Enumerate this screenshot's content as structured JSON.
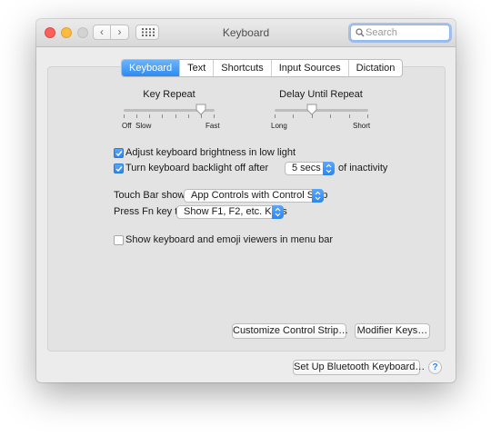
{
  "window": {
    "title": "Keyboard",
    "search_placeholder": "Search"
  },
  "tabs": [
    "Keyboard",
    "Text",
    "Shortcuts",
    "Input Sources",
    "Dictation"
  ],
  "active_tab": "Keyboard",
  "key_repeat": {
    "label": "Key Repeat",
    "left_labels": [
      "Off",
      "Slow"
    ],
    "right_label": "Fast",
    "level": 0.85
  },
  "delay_repeat": {
    "label": "Delay Until Repeat",
    "left_label": "Long",
    "right_label": "Short",
    "level": 0.4
  },
  "options": {
    "brightness": {
      "label": "Adjust keyboard brightness in low light",
      "checked": true
    },
    "backlight": {
      "label": "Turn keyboard backlight off after",
      "checked": true,
      "value": "5 secs",
      "suffix": "of inactivity"
    },
    "emoji": {
      "label": "Show keyboard and emoji viewers in menu bar",
      "checked": false
    }
  },
  "touchbar": {
    "label": "Touch Bar shows",
    "value": "App Controls with Control Strip"
  },
  "fnkey": {
    "label": "Press Fn key to",
    "value": "Show F1, F2, etc. Keys"
  },
  "buttons": {
    "customize": "Customize Control Strip…",
    "modifier": "Modifier Keys…",
    "bluetooth": "Set Up Bluetooth Keyboard…",
    "help": "?"
  },
  "colors": {
    "accent": "#2d8bf0",
    "close": "#fc605c",
    "minimize": "#fdbc40"
  }
}
